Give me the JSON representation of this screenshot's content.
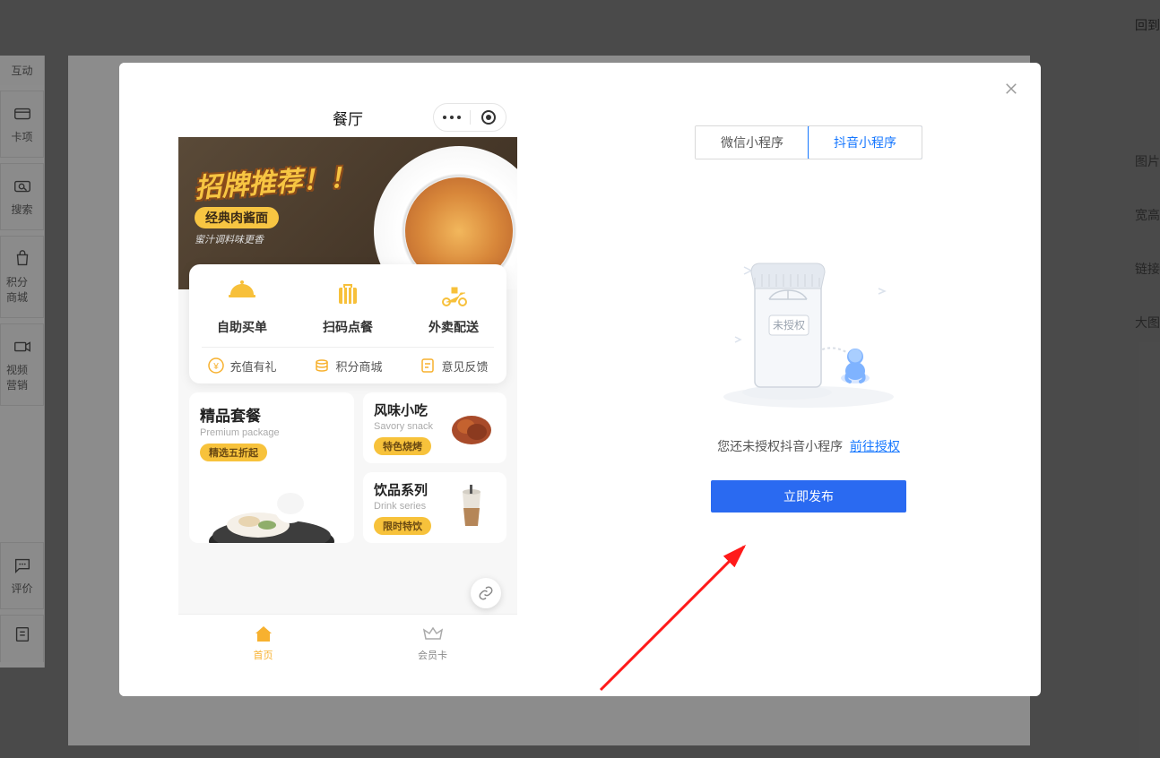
{
  "header_right": "回到",
  "sidebar": {
    "items": [
      {
        "label": "互动"
      },
      {
        "label": "卡项"
      },
      {
        "label": "搜索"
      },
      {
        "label": "积分商城"
      },
      {
        "label": "视频营销"
      },
      {
        "label": "评价"
      }
    ]
  },
  "right_col": {
    "items": [
      "图片",
      "宽高",
      "链接",
      "大图"
    ]
  },
  "modal": {
    "close": "关闭",
    "phone": {
      "title": "餐厅",
      "banner": {
        "title": "招牌推荐！！",
        "subtitle": "经典肉酱面",
        "tagline": "蜜汁调料味更香"
      },
      "menu1": [
        "自助买单",
        "扫码点餐",
        "外卖配送"
      ],
      "menu2": [
        "充值有礼",
        "积分商城",
        "意见反馈"
      ],
      "cat": {
        "left_title": "精品套餐",
        "left_sub": "Premium package",
        "left_badge": "精选五折起",
        "r1_title": "风味小吃",
        "r1_sub": "Savory snack",
        "r1_badge": "特色烧烤",
        "r2_title": "饮品系列",
        "r2_sub": "Drink series",
        "r2_badge": "限时特饮"
      },
      "tabs": [
        "首页",
        "会员卡"
      ]
    },
    "platform_tabs": [
      "微信小程序",
      "抖音小程序"
    ],
    "empty_badge": "未授权",
    "auth_message": "您还未授权抖音小程序",
    "auth_link": "前往授权",
    "publish_button": "立即发布"
  }
}
